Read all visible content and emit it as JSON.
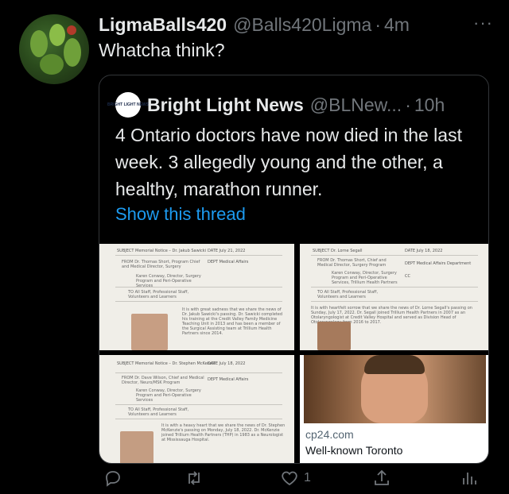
{
  "tweet": {
    "display_name": "LigmaBalls420",
    "handle": "@Balls420Ligma",
    "separator": "·",
    "time": "4m",
    "text": "Whatcha think?",
    "more": "···"
  },
  "quote": {
    "logo_text": "BRIGHT LIGHT NEWS",
    "name": "Bright Light News",
    "handle": "@BLNew...",
    "separator": "·",
    "time": "10h",
    "text": "4 Ontario doctors have now died in the last week. 3 allegedly young and the other, a healthy, marathon runner.",
    "show_thread": "Show this thread"
  },
  "images": {
    "memo1": {
      "subject": "SUBJECT  Memorial Notice – Dr. Jakub Sawicki",
      "date": "DATE   July 21, 2022",
      "from": "FROM  Dr. Thomas Short, Program Chief and Medical Director, Surgery",
      "dept": "DEPT   Medical Affairs",
      "cc": "Karen Conway, Director, Surgery Program and Peri-Operative Services",
      "to": "TO  All Staff, Professional Staff, Volunteers and Learners",
      "body": "It is with great sadness that we share the news of Dr. Jakub Sawicki's passing. Dr. Sawicki completed his training at the Credit Valley Family Medicine Teaching Unit in 2013 and has been a member of the Surgical Assisting team at Trillium Health Partners since 2014."
    },
    "memo2": {
      "subject": "SUBJECT  Dr. Lorne Segall",
      "date": "DATE   July 18, 2022",
      "from": "FROM  Dr. Thomas Short, Chief and Medical Director, Surgery Program",
      "dept": "DEPT   Medical Affairs Department",
      "cc": "Karen Conway, Director, Surgery Program and Peri-Operative Services, Trillium Health Partners",
      "cc_label": "CC",
      "to": "TO  All Staff, Professional Staff, Volunteers and Learners",
      "body": "It is with heartfelt sorrow that we share the news of Dr. Lorne Segall's passing on Sunday, July 17, 2022. Dr. Segall joined Trillium Health Partners in 2007 as an Otolaryngologist at Credit Valley Hospital and served as Division Head of Otolaryngology from 2016 to 2017."
    },
    "memo3": {
      "subject": "SUBJECT  Memorial Notice – Dr. Stephen McKenzie",
      "date": "DATE   July 18, 2022",
      "from": "FROM  Dr. Dave Wilson, Chief and Medical Director, Neuro/MSK Program",
      "dept": "DEPT   Medical Affairs",
      "cc": "Karen Conway, Director, Surgery Program and Peri-Operative Services",
      "to": "TO  All Staff, Professional Staff, Volunteers and Learners",
      "body": "It is with a heavy heart that we share the news of Dr. Stephen McKenzie's passing on Monday, July 18, 2022. Dr. McKenzie joined Trillium Health Partners (THP) in 1983 as a Neurologist at Mississauga Hospital."
    },
    "card": {
      "domain": "cp24.com",
      "title": "Well-known Toronto"
    }
  },
  "actions": {
    "reply_icon": "reply-icon",
    "retweet_icon": "retweet-icon",
    "like_icon": "heart-icon",
    "like_count": "1",
    "share_icon": "share-icon",
    "analytics_icon": "analytics-icon"
  },
  "colors": {
    "background": "#000000",
    "text": "#e7e9ea",
    "secondary": "#71767b",
    "link": "#1d9bf0",
    "border": "#333639"
  }
}
